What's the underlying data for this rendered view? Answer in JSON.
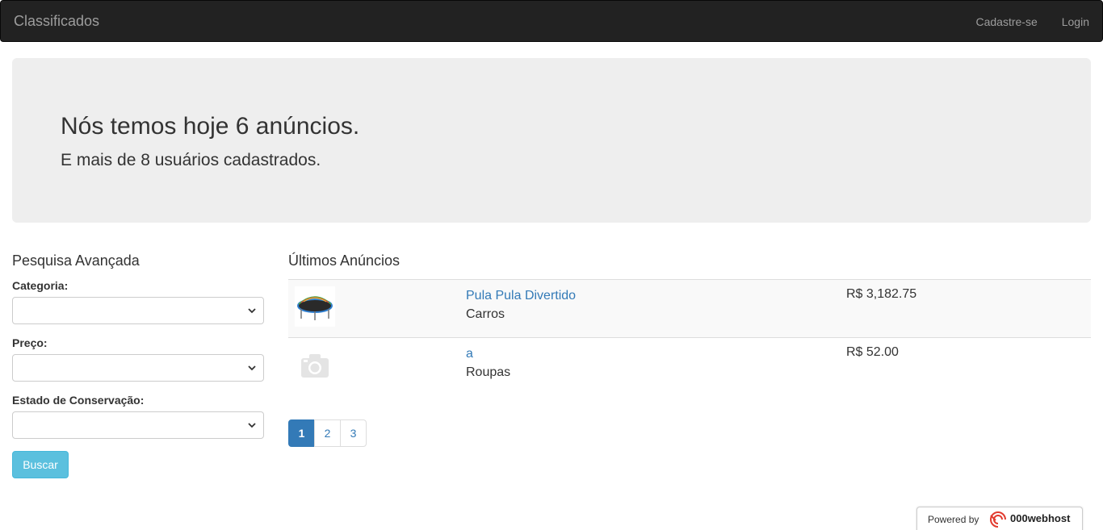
{
  "navbar": {
    "brand": "Classificados",
    "links": [
      "Cadastre-se",
      "Login"
    ]
  },
  "jumbotron": {
    "heading": "Nós temos hoje 6 anúncios.",
    "subheading": "E mais de 8 usuários cadastrados."
  },
  "search": {
    "title": "Pesquisa Avançada",
    "fields": [
      {
        "label": "Categoria:",
        "value": ""
      },
      {
        "label": "Preço:",
        "value": ""
      },
      {
        "label": "Estado de Conservação:",
        "value": ""
      }
    ],
    "button": "Buscar"
  },
  "listings": {
    "title": "Últimos Anúncios",
    "items": [
      {
        "title": "Pula Pula Divertido",
        "category": "Carros",
        "price": "R$ 3,182.75",
        "image": "trampoline-photo"
      },
      {
        "title": "a",
        "category": "Roupas",
        "price": "R$ 52.00",
        "image": "camera-placeholder-icon"
      }
    ]
  },
  "pagination": {
    "pages": [
      "1",
      "2",
      "3"
    ],
    "active": "1"
  },
  "footer_badge": {
    "text": "Powered by",
    "brand": "000webhost"
  },
  "colors": {
    "navbar_bg": "#222222",
    "jumbotron_bg": "#eeeeee",
    "link": "#337ab7",
    "info_button": "#5bc0de"
  }
}
